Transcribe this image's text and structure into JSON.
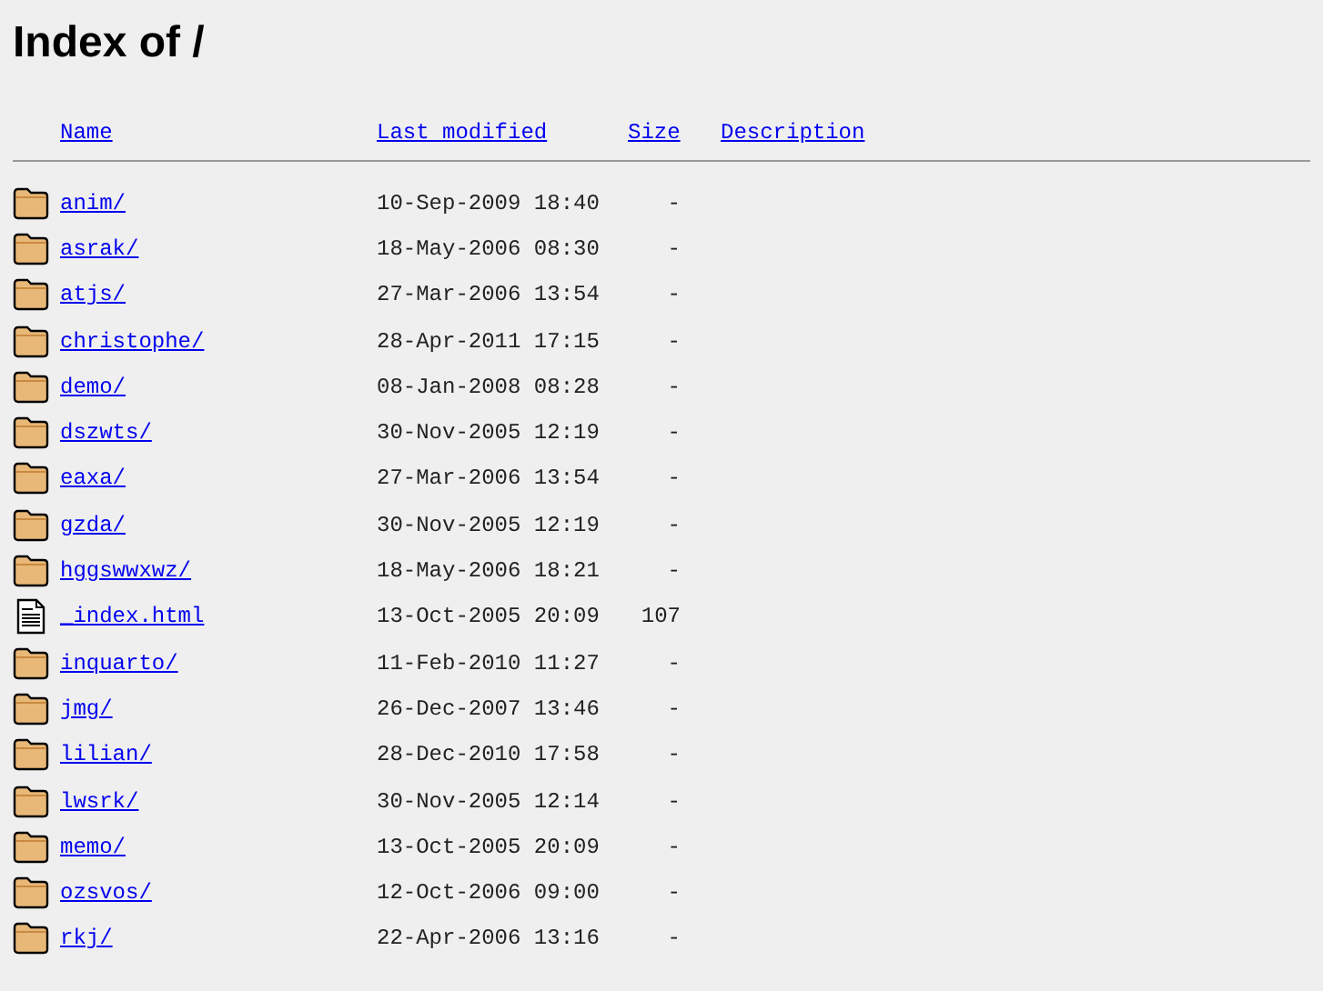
{
  "title": "Index of /",
  "columns": [
    "Name",
    "Last modified",
    "Size",
    "Description"
  ],
  "rows": [
    {
      "kind": "folder",
      "name": "anim/",
      "modified": "10-Sep-2009 18:40",
      "size": "-"
    },
    {
      "kind": "folder",
      "name": "asrak/",
      "modified": "18-May-2006 08:30",
      "size": "-"
    },
    {
      "kind": "folder",
      "name": "atjs/",
      "modified": "27-Mar-2006 13:54",
      "size": "-"
    },
    {
      "kind": "folder",
      "name": "christophe/",
      "modified": "28-Apr-2011 17:15",
      "size": "-"
    },
    {
      "kind": "folder",
      "name": "demo/",
      "modified": "08-Jan-2008 08:28",
      "size": "-"
    },
    {
      "kind": "folder",
      "name": "dszwts/",
      "modified": "30-Nov-2005 12:19",
      "size": "-"
    },
    {
      "kind": "folder",
      "name": "eaxa/",
      "modified": "27-Mar-2006 13:54",
      "size": "-"
    },
    {
      "kind": "folder",
      "name": "gzda/",
      "modified": "30-Nov-2005 12:19",
      "size": "-"
    },
    {
      "kind": "folder",
      "name": "hggswwxwz/",
      "modified": "18-May-2006 18:21",
      "size": "-"
    },
    {
      "kind": "file",
      "name": "_index.html",
      "modified": "13-Oct-2005 20:09",
      "size": "107"
    },
    {
      "kind": "folder",
      "name": "inquarto/",
      "modified": "11-Feb-2010 11:27",
      "size": "-"
    },
    {
      "kind": "folder",
      "name": "jmg/",
      "modified": "26-Dec-2007 13:46",
      "size": "-"
    },
    {
      "kind": "folder",
      "name": "lilian/",
      "modified": "28-Dec-2010 17:58",
      "size": "-"
    },
    {
      "kind": "folder",
      "name": "lwsrk/",
      "modified": "30-Nov-2005 12:14",
      "size": "-"
    },
    {
      "kind": "folder",
      "name": "memo/",
      "modified": "13-Oct-2005 20:09",
      "size": "-"
    },
    {
      "kind": "folder",
      "name": "ozsvos/",
      "modified": "12-Oct-2006 09:00",
      "size": "-"
    },
    {
      "kind": "folder",
      "name": "rkj/",
      "modified": "22-Apr-2006 13:16",
      "size": "-"
    }
  ]
}
